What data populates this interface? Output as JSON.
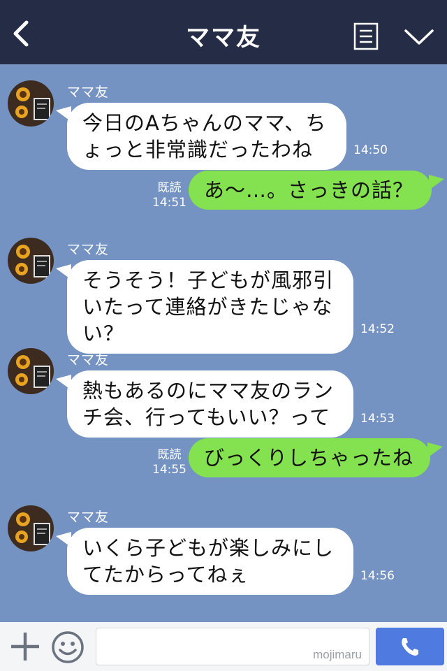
{
  "header": {
    "title": "ママ友"
  },
  "messages": [
    {
      "sender": "ママ友",
      "lines": [
        "今日のAちゃんのママ、ち",
        "ょっと非常識だったわね"
      ],
      "time": "14:50"
    },
    {
      "text": "あ〜…。さっきの話？",
      "read": "既読",
      "time": "14:51"
    },
    {
      "sender": "ママ友",
      "lines": [
        "そうそう！子どもが風邪引",
        "いたって連絡がきたじゃな",
        "い？"
      ],
      "time": "14:52"
    },
    {
      "sender": "ママ友",
      "lines": [
        "熱もあるのにママ友のラン",
        "チ会、行ってもいい？って"
      ],
      "time": "14:53"
    },
    {
      "text": "びっくりしちゃったね",
      "read": "既読",
      "time": "14:55"
    },
    {
      "sender": "ママ友",
      "lines": [
        "いくら子どもが楽しみにし",
        "てたからってねぇ"
      ],
      "time": "14:56"
    }
  ],
  "input": {
    "watermark": "mojimaru"
  },
  "colors": {
    "header": "#242d45",
    "chat_bg": "#7493c2",
    "outgoing": "#84e14f",
    "incoming": "#ffffff",
    "call": "#4f7ae0"
  },
  "icons": [
    "back-icon",
    "menu-icon",
    "chevron-down-icon",
    "avatar",
    "plus-icon",
    "smiley-icon",
    "phone-icon"
  ]
}
